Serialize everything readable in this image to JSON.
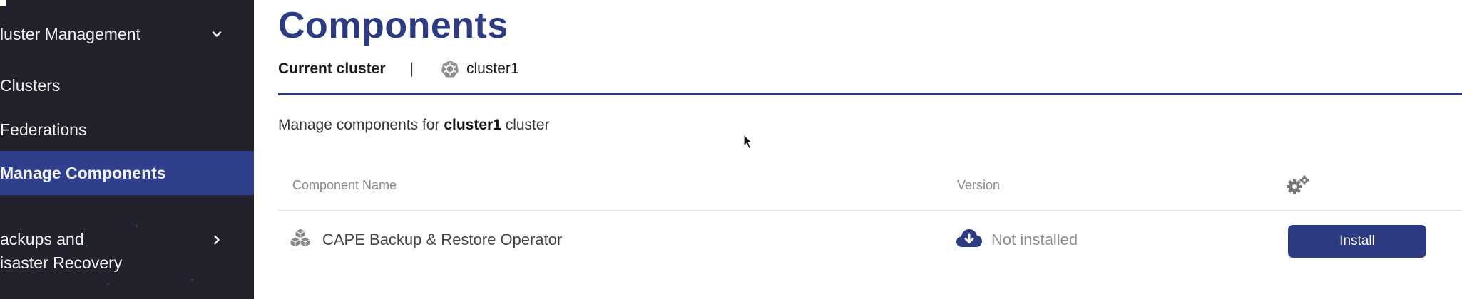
{
  "sidebar": {
    "cluster_management": "luster Management",
    "clusters": "Clusters",
    "federations": "Federations",
    "manage_components": "Manage Components",
    "backups_line1": "ackups and",
    "backups_line2": "isaster Recovery"
  },
  "main": {
    "title": "Components",
    "current_cluster_label": "Current cluster",
    "separator": "|",
    "current_cluster_name": "cluster1",
    "description_prefix": "Manage components for",
    "description_cluster": "cluster1",
    "description_suffix": "cluster"
  },
  "table": {
    "headers": {
      "name": "Component Name",
      "version": "Version"
    },
    "rows": [
      {
        "name": "CAPE Backup & Restore Operator",
        "version": "Not installed",
        "action": "Install"
      }
    ]
  },
  "colors": {
    "sidebar_bg": "#22222c",
    "accent": "#2d3b82",
    "active_item": "#2f3f8c"
  }
}
